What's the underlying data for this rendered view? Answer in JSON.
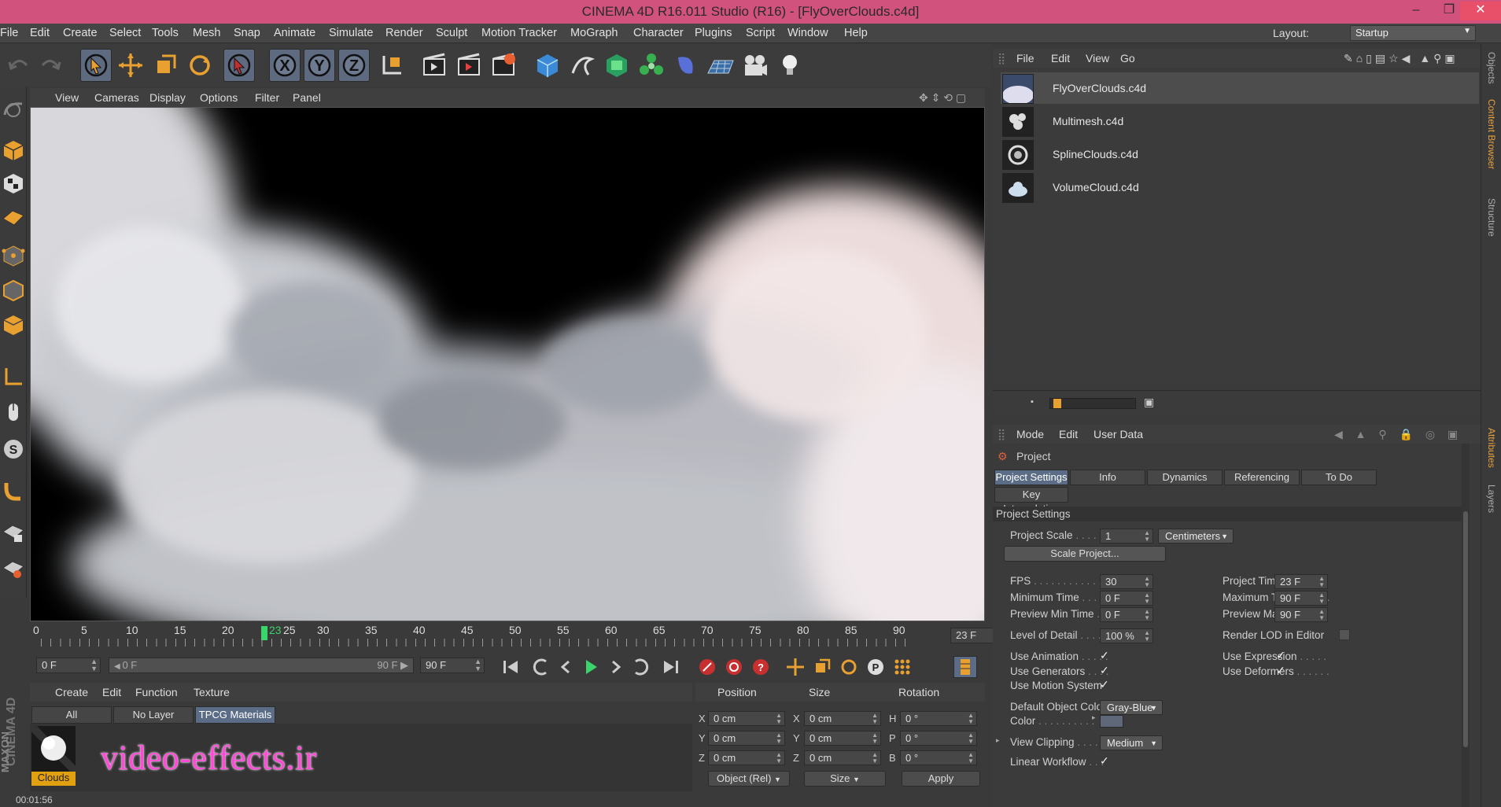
{
  "window": {
    "title": "CINEMA 4D R16.011 Studio (R16) - [FlyOverClouds.c4d]",
    "minimize": "–",
    "maximize": "❐",
    "close": "✕"
  },
  "menubar": {
    "items": [
      "File",
      "Edit",
      "Create",
      "Select",
      "Tools",
      "Mesh",
      "Snap",
      "Animate",
      "Simulate",
      "Render",
      "Sculpt",
      "Motion Tracker",
      "MoGraph",
      "Character",
      "Plugins",
      "Script",
      "Window",
      "Help"
    ],
    "layout_label": "Layout:",
    "layout_value": "Startup"
  },
  "viewport": {
    "menu": [
      "View",
      "Cameras",
      "Display",
      "Options",
      "Filter",
      "Panel"
    ]
  },
  "timeline": {
    "ticks": [
      "0",
      "5",
      "10",
      "15",
      "20",
      "25",
      "30",
      "35",
      "40",
      "45",
      "50",
      "55",
      "60",
      "65",
      "70",
      "75",
      "80",
      "85",
      "90"
    ],
    "current_frame": "23",
    "current_field": "23 F"
  },
  "transport": {
    "start_field": "0 F",
    "range_left": "0 F",
    "range_right": "90 F",
    "end_field": "90 F"
  },
  "material_manager": {
    "menu": [
      "Create",
      "Edit",
      "Function",
      "Texture"
    ],
    "tabs": [
      "All",
      "No Layer",
      "TPCG Materials"
    ],
    "active_tab": "TPCG Materials",
    "material_name": "Clouds",
    "watermark": "video-effects.ir"
  },
  "coordinates": {
    "headers": [
      "Position",
      "Size",
      "Rotation"
    ],
    "rows": [
      {
        "axis": "X",
        "pos": "0 cm",
        "saxis": "X",
        "size": "0 cm",
        "raxis": "H",
        "rot": "0 °"
      },
      {
        "axis": "Y",
        "pos": "0 cm",
        "saxis": "Y",
        "size": "0 cm",
        "raxis": "P",
        "rot": "0 °"
      },
      {
        "axis": "Z",
        "pos": "0 cm",
        "saxis": "Z",
        "size": "0 cm",
        "raxis": "B",
        "rot": "0 °"
      }
    ],
    "mode": "Object (Rel)",
    "size_mode": "Size",
    "apply": "Apply"
  },
  "status": {
    "time": "00:01:56"
  },
  "branding": {
    "vertical": "CINEMA 4D",
    "maxon": "MAXON"
  },
  "content_browser": {
    "menu": [
      "File",
      "Edit",
      "View",
      "Go"
    ],
    "items": [
      "FlyOverClouds.c4d",
      "Multimesh.c4d",
      "SplineClouds.c4d",
      "VolumeCloud.c4d"
    ],
    "selected": "FlyOverClouds.c4d"
  },
  "attributes": {
    "menu": [
      "Mode",
      "Edit",
      "User Data"
    ],
    "object": "Project",
    "tabs": [
      "Project Settings",
      "Info",
      "Dynamics",
      "Referencing",
      "To Do"
    ],
    "tabs2": [
      "Key Interpolation"
    ],
    "section": "Project Settings",
    "project_scale_label": "Project Scale",
    "project_scale": "1",
    "project_scale_unit": "Centimeters",
    "scale_button": "Scale Project...",
    "fps_label": "FPS",
    "fps": "30",
    "project_time_label": "Project Time",
    "project_time": "23 F",
    "min_time_label": "Minimum Time",
    "min_time": "0 F",
    "max_time_label": "Maximum Time",
    "max_time": "90 F",
    "pmin_label": "Preview Min Time",
    "pmin": "0 F",
    "pmax_label": "Preview Max Time",
    "pmax": "90 F",
    "lod_label": "Level of Detail",
    "lod": "100 %",
    "render_lod_label": "Render LOD in Editor",
    "use_anim_label": "Use Animation",
    "use_expr_label": "Use Expression",
    "use_gen_label": "Use Generators",
    "use_def_label": "Use Deformers",
    "use_motion_label": "Use Motion System",
    "default_color_label": "Default Object Color",
    "default_color": "Gray-Blue",
    "color_label": "Color",
    "view_clip_label": "View Clipping",
    "view_clip": "Medium",
    "linear_label": "Linear Workflow"
  },
  "side_tabs": [
    "Objects",
    "Content Browser",
    "Structure",
    "Attributes",
    "Layers"
  ],
  "colors": {
    "title_bar": "#d1527c",
    "accent_selected": "#5b6c87",
    "watermark": "#ff4ad8",
    "playhead": "#3ad56a",
    "material_label": "#e0a010"
  }
}
